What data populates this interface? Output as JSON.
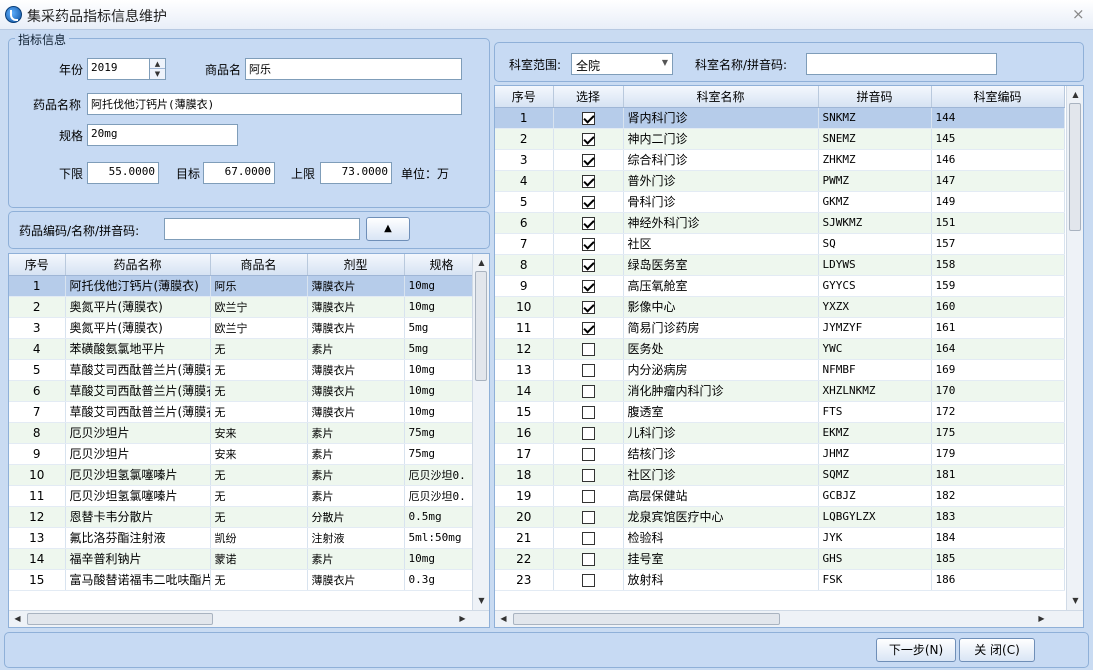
{
  "window": {
    "title": "集采药品指标信息维护",
    "close": "×"
  },
  "indicator": {
    "legend": "指标信息",
    "year_label": "年份",
    "year_value": "2019",
    "trade_label": "商品名",
    "trade_value": "阿乐",
    "drug_label": "药品名称",
    "drug_value": "阿托伐他汀钙片(薄膜衣)",
    "spec_label": "规格",
    "spec_value": "20mg",
    "lower_label": "下限",
    "lower_value": "55.0000",
    "target_label": "目标",
    "target_value": "67.0000",
    "upper_label": "上限",
    "upper_value": "73.0000",
    "unit_label": "单位：万"
  },
  "search": {
    "label": "药品编码/名称/拼音码:",
    "value": "",
    "button": "▲"
  },
  "drugs": {
    "columns": [
      "序号",
      "药品名称",
      "商品名",
      "剂型",
      "规格"
    ],
    "rows": [
      [
        "1",
        "阿托伐他汀钙片(薄膜衣)",
        "阿乐",
        "薄膜衣片",
        "10mg"
      ],
      [
        "2",
        "奥氮平片(薄膜衣)",
        "欧兰宁",
        "薄膜衣片",
        "10mg"
      ],
      [
        "3",
        "奥氮平片(薄膜衣)",
        "欧兰宁",
        "薄膜衣片",
        "5mg"
      ],
      [
        "4",
        "苯磺酸氨氯地平片",
        "无",
        "素片",
        "5mg"
      ],
      [
        "5",
        "草酸艾司西酞普兰片(薄膜衣)",
        "无",
        "薄膜衣片",
        "10mg"
      ],
      [
        "6",
        "草酸艾司西酞普兰片(薄膜衣)",
        "无",
        "薄膜衣片",
        "10mg"
      ],
      [
        "7",
        "草酸艾司西酞普兰片(薄膜衣)",
        "无",
        "薄膜衣片",
        "10mg"
      ],
      [
        "8",
        "厄贝沙坦片",
        "安来",
        "素片",
        "75mg"
      ],
      [
        "9",
        "厄贝沙坦片",
        "安来",
        "素片",
        "75mg"
      ],
      [
        "10",
        "厄贝沙坦氢氯噻嗪片",
        "无",
        "素片",
        "厄贝沙坦0."
      ],
      [
        "11",
        "厄贝沙坦氢氯噻嗪片",
        "无",
        "素片",
        "厄贝沙坦0."
      ],
      [
        "12",
        "恩替卡韦分散片",
        "无",
        "分散片",
        "0.5mg"
      ],
      [
        "13",
        "氟比洛芬酯注射液",
        "凯纷",
        "注射液",
        "5ml:50mg"
      ],
      [
        "14",
        "福辛普利钠片",
        "蒙诺",
        "素片",
        "10mg"
      ],
      [
        "15",
        "富马酸替诺福韦二吡呋酯片",
        "无",
        "薄膜衣片",
        "0.3g"
      ]
    ]
  },
  "dept_filter": {
    "scope_label": "科室范围:",
    "scope_value": "全院",
    "name_label": "科室名称/拼音码:",
    "name_value": ""
  },
  "depts": {
    "columns": [
      "序号",
      "选择",
      "科室名称",
      "拼音码",
      "科室编码"
    ],
    "rows": [
      [
        "1",
        true,
        "肾内科门诊",
        "SNKMZ",
        "144"
      ],
      [
        "2",
        true,
        "神内二门诊",
        "SNEMZ",
        "145"
      ],
      [
        "3",
        true,
        "综合科门诊",
        "ZHKMZ",
        "146"
      ],
      [
        "4",
        true,
        "普外门诊",
        "PWMZ",
        "147"
      ],
      [
        "5",
        true,
        "骨科门诊",
        "GKMZ",
        "149"
      ],
      [
        "6",
        true,
        "神经外科门诊",
        "SJWKMZ",
        "151"
      ],
      [
        "7",
        true,
        "社区",
        "SQ",
        "157"
      ],
      [
        "8",
        true,
        "绿岛医务室",
        "LDYWS",
        "158"
      ],
      [
        "9",
        true,
        "高压氧舱室",
        "GYYCS",
        "159"
      ],
      [
        "10",
        true,
        "影像中心",
        "YXZX",
        "160"
      ],
      [
        "11",
        true,
        "简易门诊药房",
        "JYMZYF",
        "161"
      ],
      [
        "12",
        false,
        "医务处",
        "YWC",
        "164"
      ],
      [
        "13",
        false,
        "内分泌病房",
        "NFMBF",
        "169"
      ],
      [
        "14",
        false,
        "消化肿瘤内科门诊",
        "XHZLNKMZ",
        "170"
      ],
      [
        "15",
        false,
        "腹透室",
        "FTS",
        "172"
      ],
      [
        "16",
        false,
        "儿科门诊",
        "EKMZ",
        "175"
      ],
      [
        "17",
        false,
        "结核门诊",
        "JHMZ",
        "179"
      ],
      [
        "18",
        false,
        "社区门诊",
        "SQMZ",
        "181"
      ],
      [
        "19",
        false,
        "高层保健站",
        "GCBJZ",
        "182"
      ],
      [
        "20",
        false,
        "龙泉宾馆医疗中心",
        "LQBGYLZX",
        "183"
      ],
      [
        "21",
        false,
        "检验科",
        "JYK",
        "184"
      ],
      [
        "22",
        false,
        "挂号室",
        "GHS",
        "185"
      ],
      [
        "23",
        false,
        "放射科",
        "FSK",
        "186"
      ]
    ]
  },
  "footer": {
    "next": "下一步(N)",
    "close": "关 闭(C)"
  }
}
